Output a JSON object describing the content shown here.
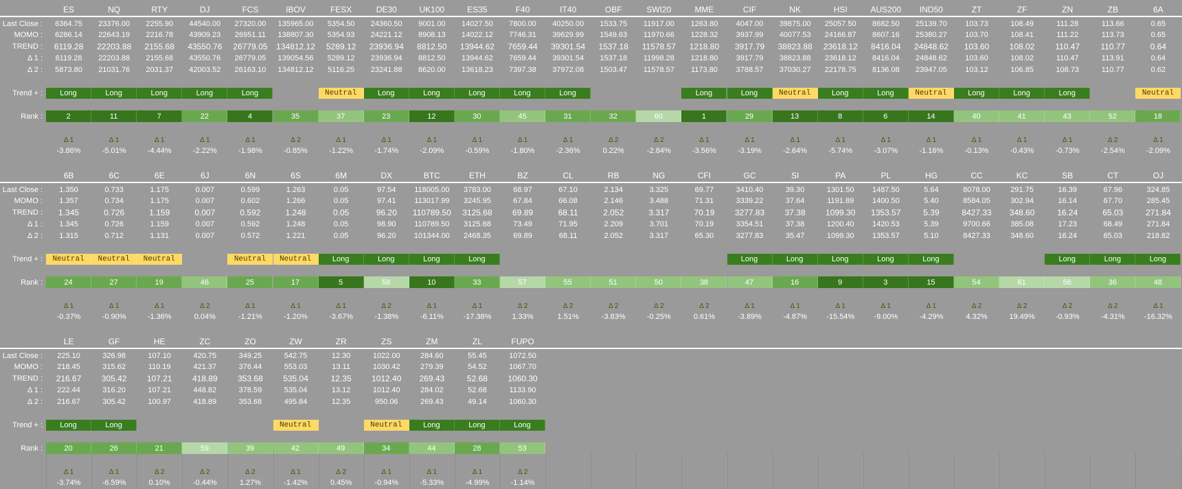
{
  "labels": {
    "last_close": "Last Close :",
    "momo": "MOMO :",
    "trend": "TREND :",
    "d1": "Δ 1 :",
    "d2": "Δ 2 :",
    "trend_plus": "Trend + :",
    "rank": "Rank :"
  },
  "colors": {
    "long": "#397d1f",
    "neutral": "#ffd966",
    "background": "#9a9a9a",
    "rank_scale": [
      "#38761d",
      "#6aa84f",
      "#93c47d",
      "#b6d7a8"
    ]
  },
  "blocks": [
    {
      "symbols": [
        "ES",
        "NQ",
        "RTY",
        "DJ",
        "FCS",
        "IBOV",
        "FESX",
        "DE30",
        "UK100",
        "ES35",
        "F40",
        "IT40",
        "OBF",
        "SWI20",
        "MME",
        "CIF",
        "NK",
        "HSI",
        "AUS200",
        "IND50",
        "ZT",
        "ZF",
        "ZN",
        "ZB",
        "6A"
      ],
      "last_close": [
        "6364.75",
        "23376.00",
        "2255.90",
        "44540.00",
        "27320.00",
        "135965.00",
        "5354.50",
        "24360.50",
        "9001.00",
        "14027.50",
        "7800.00",
        "40250.00",
        "1533.75",
        "11917.00",
        "1263.80",
        "4047.00",
        "39875.00",
        "25057.50",
        "8682.50",
        "25139.70",
        "103.73",
        "108.49",
        "111.28",
        "113.66",
        "0.65"
      ],
      "momo": [
        "6286.14",
        "22643.19",
        "2216.78",
        "43909.23",
        "26951.11",
        "138807.30",
        "5354.93",
        "24221.12",
        "8908.13",
        "14022.12",
        "7746.31",
        "39629.99",
        "1549.63",
        "11970.66",
        "1228.32",
        "3937.99",
        "40077.53",
        "24166.87",
        "8607.16",
        "25380.27",
        "103.70",
        "108.41",
        "111.22",
        "113.73",
        "0.65"
      ],
      "trend": [
        "6119.28",
        "22203.88",
        "2155.68",
        "43550.76",
        "26779.05",
        "134812.12",
        "5289.12",
        "23936.94",
        "8812.50",
        "13944.62",
        "7659.44",
        "39301.54",
        "1537.18",
        "11578.57",
        "1218.80",
        "3917.79",
        "38823.88",
        "23618.12",
        "8416.04",
        "24848.62",
        "103.60",
        "108.02",
        "110.47",
        "110.77",
        "0.64"
      ],
      "d1": [
        "6119.28",
        "22203.88",
        "2155.68",
        "43550.76",
        "26779.05",
        "139054.56",
        "5289.12",
        "23936.94",
        "8812.50",
        "13944.62",
        "7659.44",
        "39301.54",
        "1537.18",
        "11998.28",
        "1218.80",
        "3917.79",
        "38823.88",
        "23618.12",
        "8416.04",
        "24848.62",
        "103.60",
        "108.02",
        "110.47",
        "113.91",
        "0.64"
      ],
      "d2": [
        "5873.80",
        "21031.76",
        "2031.37",
        "42003.52",
        "26163.10",
        "134812.12",
        "5116.25",
        "23241.88",
        "8620.00",
        "13618.23",
        "7397.38",
        "37972.08",
        "1503.47",
        "11578.57",
        "1173.80",
        "3788.57",
        "37030.27",
        "22178.75",
        "8136.08",
        "23947.05",
        "103.12",
        "106.85",
        "108.73",
        "110.77",
        "0.62"
      ],
      "trend_plus": [
        "Long",
        "Long",
        "Long",
        "Long",
        "Long",
        "",
        "Neutral",
        "Long",
        "Long",
        "Long",
        "Long",
        "Long",
        "",
        "",
        "Long",
        "Long",
        "Neutral",
        "Long",
        "Long",
        "Neutral",
        "Long",
        "Long",
        "Long",
        "",
        "Neutral"
      ],
      "rank": [
        "2",
        "11",
        "7",
        "22",
        "4",
        "35",
        "37",
        "23",
        "12",
        "30",
        "45",
        "31",
        "32",
        "60",
        "1",
        "29",
        "13",
        "8",
        "6",
        "14",
        "40",
        "41",
        "43",
        "52",
        "18"
      ],
      "delta_tag": [
        "Δ 1",
        "Δ 1",
        "Δ 1",
        "Δ 1",
        "Δ 1",
        "Δ 2",
        "Δ 1",
        "Δ 1",
        "Δ 1",
        "Δ 1",
        "Δ 1",
        "Δ 1",
        "Δ 2",
        "Δ 2",
        "Δ 1",
        "Δ 1",
        "Δ 1",
        "Δ 1",
        "Δ 1",
        "Δ 1",
        "Δ 1",
        "Δ 1",
        "Δ 1",
        "Δ 2",
        "Δ 1"
      ],
      "pct": [
        "-3.86%",
        "-5.01%",
        "-4.44%",
        "-2.22%",
        "-1.98%",
        "-0.85%",
        "-1.22%",
        "-1.74%",
        "-2.09%",
        "-0.59%",
        "-1.80%",
        "-2.36%",
        "0.22%",
        "-2.84%",
        "-3.56%",
        "-3.19%",
        "-2.64%",
        "-5.74%",
        "-3.07%",
        "-1.16%",
        "-0.13%",
        "-0.43%",
        "-0.73%",
        "-2.54%",
        "-2.09%"
      ]
    },
    {
      "symbols": [
        "6B",
        "6C",
        "6E",
        "6J",
        "6N",
        "6S",
        "6M",
        "DX",
        "BTC",
        "ETH",
        "BZ",
        "CL",
        "RB",
        "NG",
        "CFI",
        "GC",
        "SI",
        "PA",
        "PL",
        "HG",
        "CC",
        "KC",
        "SB",
        "CT",
        "OJ"
      ],
      "last_close": [
        "1.350",
        "0.733",
        "1.175",
        "0.007",
        "0.599",
        "1.263",
        "0.05",
        "97.54",
        "118005.00",
        "3783.00",
        "68.97",
        "67.10",
        "2.134",
        "3.325",
        "69.77",
        "3410.40",
        "39.30",
        "1301.50",
        "1487.50",
        "5.64",
        "8078.00",
        "291.75",
        "16.39",
        "67.96",
        "324.85"
      ],
      "momo": [
        "1.357",
        "0.734",
        "1.175",
        "0.007",
        "0.602",
        "1.266",
        "0.05",
        "97.41",
        "113017.99",
        "3245.95",
        "67.84",
        "66.08",
        "2.146",
        "3.488",
        "71.31",
        "3339.22",
        "37.64",
        "1191.89",
        "1400.50",
        "5.40",
        "8584.05",
        "302.94",
        "16.14",
        "67.70",
        "285.45"
      ],
      "trend": [
        "1.345",
        "0.726",
        "1.159",
        "0.007",
        "0.592",
        "1.248",
        "0.05",
        "96.20",
        "110789.50",
        "3125.68",
        "69.89",
        "68.11",
        "2.052",
        "3.317",
        "70.19",
        "3277.83",
        "37.38",
        "1099.30",
        "1353.57",
        "5.39",
        "8427.33",
        "348.60",
        "16.24",
        "65.03",
        "271.84"
      ],
      "d1": [
        "1.345",
        "0.726",
        "1.159",
        "0.007",
        "0.592",
        "1.248",
        "0.05",
        "98.90",
        "110789.50",
        "3125.68",
        "73.49",
        "71.95",
        "2.209",
        "3.701",
        "70.19",
        "3354.51",
        "37.38",
        "1200.40",
        "1420.53",
        "5.39",
        "9700.66",
        "385.08",
        "17.23",
        "68.49",
        "271.84"
      ],
      "d2": [
        "1.315",
        "0.712",
        "1.131",
        "0.007",
        "0.572",
        "1.221",
        "0.05",
        "96.20",
        "101344.00",
        "2468.35",
        "69.89",
        "68.11",
        "2.052",
        "3.317",
        "65.30",
        "3277.83",
        "35.47",
        "1099.30",
        "1353.57",
        "5.10",
        "8427.33",
        "348.60",
        "16.24",
        "65.03",
        "218.82"
      ],
      "trend_plus": [
        "Neutral",
        "Neutral",
        "Neutral",
        "",
        "Neutral",
        "Neutral",
        "Long",
        "Long",
        "Long",
        "Long",
        "",
        "",
        "",
        "",
        "",
        "Long",
        "Long",
        "Long",
        "Long",
        "Long",
        "",
        "",
        "Long",
        "Long",
        "Long"
      ],
      "rank": [
        "24",
        "27",
        "19",
        "46",
        "25",
        "17",
        "5",
        "58",
        "10",
        "33",
        "57",
        "55",
        "51",
        "50",
        "38",
        "47",
        "16",
        "9",
        "3",
        "15",
        "54",
        "61",
        "56",
        "36",
        "48"
      ],
      "delta_tag": [
        "Δ 1",
        "Δ 1",
        "Δ 1",
        "Δ 2",
        "Δ 1",
        "Δ 1",
        "Δ 1",
        "Δ 2",
        "Δ 1",
        "Δ 1",
        "Δ 2",
        "Δ 2",
        "Δ 2",
        "Δ 2",
        "Δ 2",
        "Δ 1",
        "Δ 1",
        "Δ 1",
        "Δ 1",
        "Δ 1",
        "Δ 2",
        "Δ 2",
        "Δ 2",
        "Δ 2",
        "Δ 1"
      ],
      "pct": [
        "-0.37%",
        "-0.90%",
        "-1.36%",
        "0.04%",
        "-1.21%",
        "-1.20%",
        "-3.67%",
        "-1.38%",
        "-6.11%",
        "-17.38%",
        "1.33%",
        "1.51%",
        "-3.83%",
        "-0.25%",
        "0.61%",
        "-3.89%",
        "-4.87%",
        "-15.54%",
        "-9.00%",
        "-4.29%",
        "4.32%",
        "19.49%",
        "-0.93%",
        "-4.31%",
        "-16.32%"
      ]
    },
    {
      "symbols": [
        "LE",
        "GF",
        "HE",
        "ZC",
        "ZO",
        "ZW",
        "ZR",
        "ZS",
        "ZM",
        "ZL",
        "FUPO"
      ],
      "last_close": [
        "225.10",
        "326.98",
        "107.10",
        "420.75",
        "349.25",
        "542.75",
        "12.30",
        "1022.00",
        "284.60",
        "55.45",
        "1072.50"
      ],
      "momo": [
        "218.45",
        "315.62",
        "110.19",
        "421.37",
        "376.44",
        "553.03",
        "13.11",
        "1030.42",
        "279.39",
        "54.52",
        "1067.70"
      ],
      "trend": [
        "216.67",
        "305.42",
        "107.21",
        "418.89",
        "353.68",
        "535.04",
        "12.35",
        "1012.40",
        "269.43",
        "52.68",
        "1060.30"
      ],
      "d1": [
        "222.44",
        "316.20",
        "107.21",
        "448.82",
        "378.59",
        "535.04",
        "13.12",
        "1012.40",
        "284.02",
        "52.68",
        "1133.90"
      ],
      "d2": [
        "216.67",
        "305.42",
        "100.97",
        "418.89",
        "353.68",
        "495.84",
        "12.35",
        "950.06",
        "269.43",
        "49.14",
        "1060.30"
      ],
      "trend_plus": [
        "Long",
        "Long",
        "",
        "",
        "",
        "Neutral",
        "",
        "Neutral",
        "Long",
        "Long",
        "Long"
      ],
      "rank": [
        "20",
        "26",
        "21",
        "59",
        "39",
        "42",
        "49",
        "34",
        "44",
        "28",
        "53"
      ],
      "delta_tag": [
        "Δ 1",
        "Δ 1",
        "Δ 2",
        "Δ 2",
        "Δ 2",
        "Δ 1",
        "Δ 2",
        "Δ 1",
        "Δ 1",
        "Δ 1",
        "Δ 2"
      ],
      "pct": [
        "-3.74%",
        "-6.59%",
        "0.10%",
        "-0.44%",
        "1.27%",
        "-1.42%",
        "0.45%",
        "-0.94%",
        "-5.33%",
        "-4.99%",
        "-1.14%"
      ]
    }
  ]
}
